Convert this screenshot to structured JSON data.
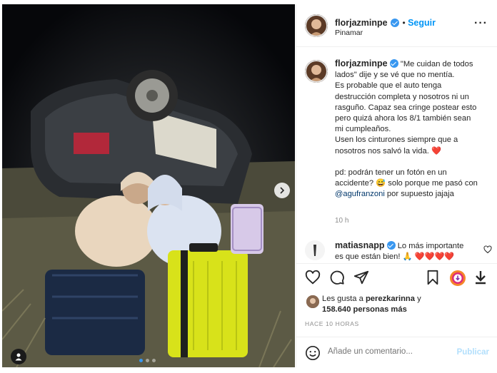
{
  "post": {
    "username": "florjazminpe",
    "follow_label": "Seguir",
    "location": "Pinamar",
    "caption_lines": [
      "\"Me cuidan de todos",
      "lados\" dije y se vé que no mentía.",
      "Es probable que el auto tenga",
      "destrucción completa y nosotros ni un",
      "rasguño. Capaz sea cringe postear esto",
      "pero quizá ahora los 8/1 también sean",
      "mi cumpleaños.",
      "Usen los cinturones siempre que a",
      "nosotros nos salvó la vida."
    ],
    "caption_ps_1": "pd: podrán tener un fotón en un",
    "caption_ps_2": "accidente? 😅 solo porque me pasó con",
    "caption_mention": "@agufranzoni",
    "caption_ps_3": " por supuesto jajaja",
    "caption_time": "10 h",
    "heart_emoji": "❤️"
  },
  "comment": {
    "username": "matiasnapp",
    "text": "Lo más importante",
    "text_line2": "es que están bien! 🙏 ❤️❤️❤️❤️"
  },
  "likes": {
    "prefix": "Les gusta a ",
    "user": "perezkarinna",
    "suffix": " y",
    "count_text": "158.640 personas más"
  },
  "timestamp": "HACE 10 HORAS",
  "add_comment": {
    "placeholder": "Añade un comentario...",
    "publish_label": "Publicar"
  },
  "carousel": {
    "total": 3,
    "active": 1
  },
  "colors": {
    "accent": "#0095f6",
    "verified": "#3897f0",
    "heart": "#e0245e"
  },
  "icons": [
    "more-options-icon",
    "heart-icon",
    "comment-icon",
    "share-icon",
    "bookmark-icon",
    "tag-icon",
    "chevron-right-icon",
    "emoji-icon",
    "download-icon"
  ]
}
